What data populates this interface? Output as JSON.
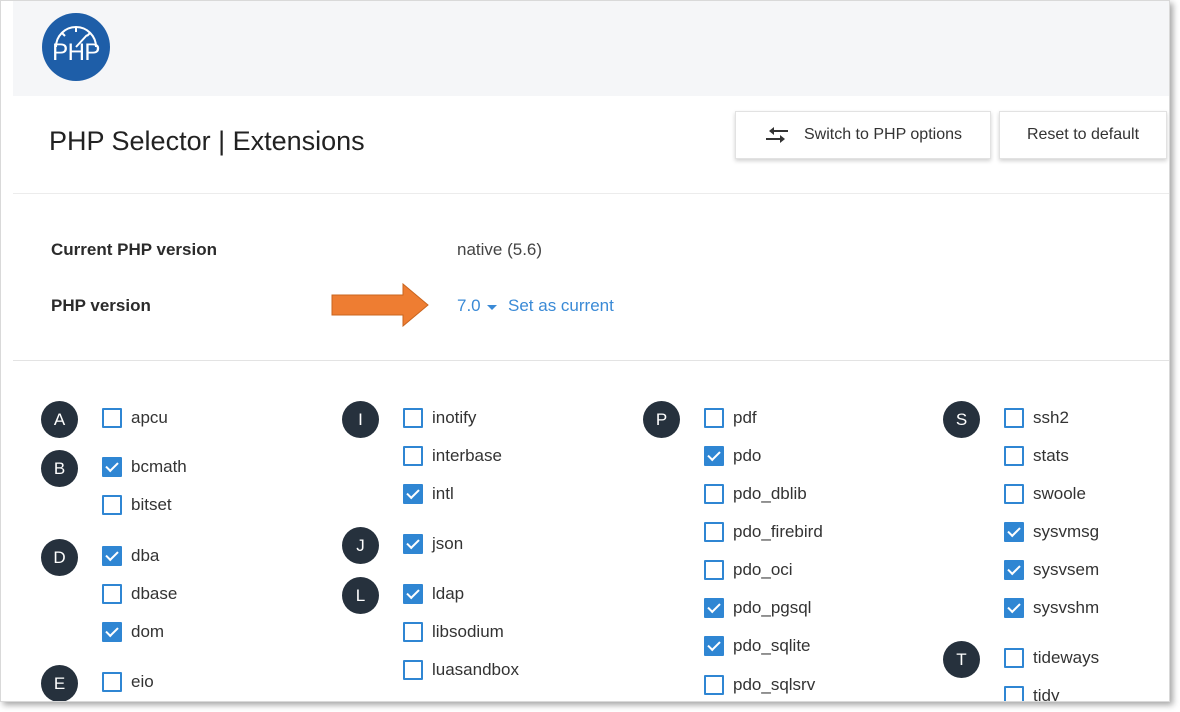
{
  "logo": {
    "text": "PHP"
  },
  "header": {
    "title": "PHP Selector | Extensions",
    "switch_label": "Switch to PHP options",
    "reset_label": "Reset to default"
  },
  "info": {
    "current_label": "Current PHP version",
    "current_value": "native (5.6)",
    "version_label": "PHP version",
    "version_value": "7.0",
    "set_current": "Set as current"
  },
  "colors": {
    "accent": "#2f86d3",
    "arrow": "#ee7d32",
    "badge": "#26313d",
    "logo": "#1e5ea8"
  },
  "extensions": [
    {
      "letter": "A",
      "label": "apcu",
      "checked": false
    },
    {
      "letter": "B",
      "label": "bcmath",
      "checked": true
    },
    {
      "letter": "",
      "label": "bitset",
      "checked": false
    },
    {
      "letter": "D",
      "label": "dba",
      "checked": true
    },
    {
      "letter": "",
      "label": "dbase",
      "checked": false
    },
    {
      "letter": "",
      "label": "dom",
      "checked": true
    },
    {
      "letter": "E",
      "label": "eio",
      "checked": false
    },
    {
      "letter": "I",
      "label": "inotify",
      "checked": false
    },
    {
      "letter": "",
      "label": "interbase",
      "checked": false
    },
    {
      "letter": "",
      "label": "intl",
      "checked": true
    },
    {
      "letter": "J",
      "label": "json",
      "checked": true
    },
    {
      "letter": "L",
      "label": "ldap",
      "checked": true
    },
    {
      "letter": "",
      "label": "libsodium",
      "checked": false
    },
    {
      "letter": "",
      "label": "luasandbox",
      "checked": false
    },
    {
      "letter": "P",
      "label": "pdf",
      "checked": false
    },
    {
      "letter": "",
      "label": "pdo",
      "checked": true
    },
    {
      "letter": "",
      "label": "pdo_dblib",
      "checked": false
    },
    {
      "letter": "",
      "label": "pdo_firebird",
      "checked": false
    },
    {
      "letter": "",
      "label": "pdo_oci",
      "checked": false
    },
    {
      "letter": "",
      "label": "pdo_pgsql",
      "checked": true
    },
    {
      "letter": "",
      "label": "pdo_sqlite",
      "checked": true
    },
    {
      "letter": "",
      "label": "pdo_sqlsrv",
      "checked": false
    },
    {
      "letter": "S",
      "label": "ssh2",
      "checked": false
    },
    {
      "letter": "",
      "label": "stats",
      "checked": false
    },
    {
      "letter": "",
      "label": "swoole",
      "checked": false
    },
    {
      "letter": "",
      "label": "sysvmsg",
      "checked": true
    },
    {
      "letter": "",
      "label": "sysvsem",
      "checked": true
    },
    {
      "letter": "",
      "label": "sysvshm",
      "checked": true
    },
    {
      "letter": "T",
      "label": "tideways",
      "checked": false
    },
    {
      "letter": "",
      "label": "tidy",
      "checked": false
    }
  ]
}
